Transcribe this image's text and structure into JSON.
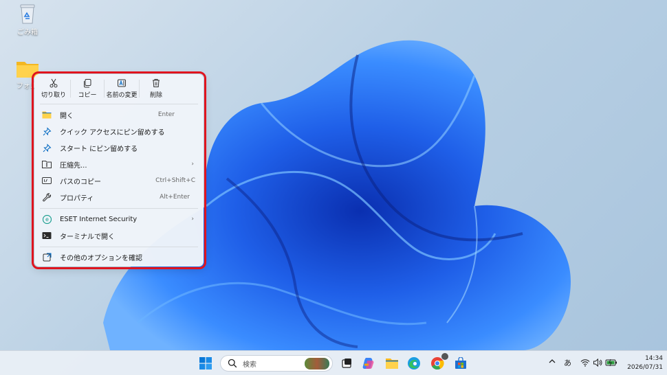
{
  "desktop": {
    "recycle_bin_label": "ごみ箱",
    "folder_label": "フォル"
  },
  "context_menu": {
    "quick_actions": [
      {
        "label": "切り取り",
        "icon": "scissors-icon"
      },
      {
        "label": "コピー",
        "icon": "copy-icon"
      },
      {
        "label": "名前の変更",
        "icon": "rename-icon"
      },
      {
        "label": "削除",
        "icon": "trash-icon"
      }
    ],
    "items": [
      {
        "label": "開く",
        "shortcut": "Enter",
        "icon": "folder-icon"
      },
      {
        "label": "クイック アクセスにピン留めする",
        "shortcut": "",
        "icon": "pin-icon"
      },
      {
        "label": "スタート にピン留めする",
        "shortcut": "",
        "icon": "pin-icon"
      },
      {
        "label": "圧縮先...",
        "shortcut": "",
        "icon": "archive-icon",
        "submenu": "›"
      },
      {
        "label": "パスのコピー",
        "shortcut": "Ctrl+Shift+C",
        "icon": "path-icon"
      },
      {
        "label": "プロパティ",
        "shortcut": "Alt+Enter",
        "icon": "wrench-icon"
      },
      {
        "label": "ESET Internet Security",
        "shortcut": "",
        "icon": "eset-icon",
        "submenu": "›"
      },
      {
        "label": "ターミナルで開く",
        "shortcut": "",
        "icon": "terminal-icon"
      },
      {
        "label": "その他のオプションを確認",
        "shortcut": "",
        "icon": "more-options-icon"
      }
    ]
  },
  "taskbar": {
    "search_placeholder": "検索",
    "ime_label": "あ",
    "tray_chevron": "^",
    "time": "14:34",
    "date": "2026/07/31"
  },
  "colors": {
    "highlight_outline": "#e0141e",
    "accent": "#0067c0"
  }
}
